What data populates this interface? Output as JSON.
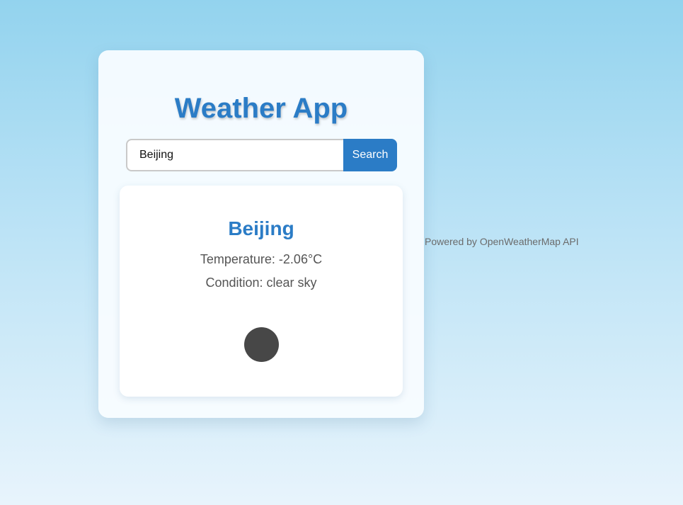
{
  "app": {
    "title": "Weather App"
  },
  "search": {
    "value": "Beijing",
    "button_label": "Search"
  },
  "weather": {
    "city": "Beijing",
    "temperature_label": "Temperature:",
    "temperature_value": "-2.06°C",
    "condition_label": "Condition:",
    "condition_value": "clear sky",
    "icon": "weather-icon-circle"
  },
  "footer": {
    "credit": "Powered by OpenWeatherMap API"
  },
  "colors": {
    "accent": "#2b7cc6",
    "text_muted": "#555555",
    "icon_fill": "#474747"
  }
}
